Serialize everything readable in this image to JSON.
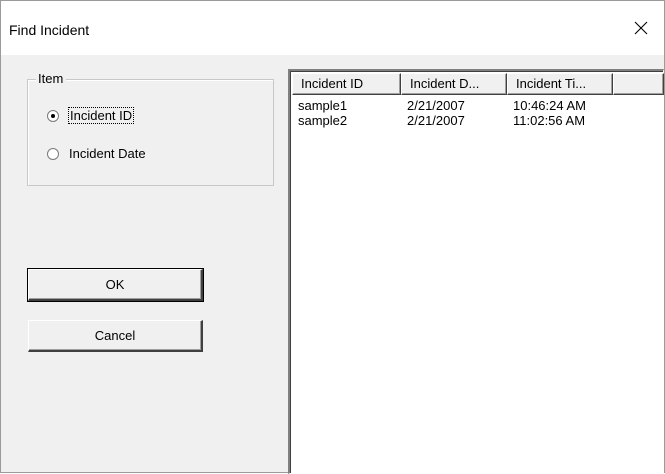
{
  "window": {
    "title": "Find Incident"
  },
  "item_group": {
    "legend": "Item",
    "options": [
      {
        "label": "Incident ID",
        "checked": true
      },
      {
        "label": "Incident Date",
        "checked": false
      }
    ]
  },
  "buttons": {
    "ok": "OK",
    "cancel": "Cancel"
  },
  "list": {
    "columns": [
      "Incident ID",
      "Incident D...",
      "Incident Ti..."
    ],
    "rows": [
      [
        "sample1",
        "2/21/2007",
        "10:46:24 AM"
      ],
      [
        "sample2",
        "2/21/2007",
        "11:02:56 AM"
      ]
    ]
  }
}
